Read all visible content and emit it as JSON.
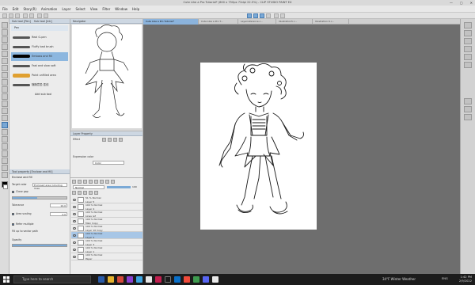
{
  "window": {
    "title": "Cute Like a Pro Tutorial* (600 x 750px 72dpi 22.5%) - CLIP STUDIO PAINT EX",
    "controls": [
      "—",
      "▢",
      "✕"
    ]
  },
  "menu": [
    "File",
    "Edit",
    "Story(R)",
    "Animation",
    "Layer",
    "Select",
    "View",
    "Filter",
    "Window",
    "Help"
  ],
  "subtool": {
    "tab_labels": [
      "Sub tool [Pen]",
      "Sub tool [Ink]"
    ],
    "items": [
      {
        "label": "Pen"
      },
      {
        "label": "Real G-pen"
      },
      {
        "label": "Fluffy bad brush"
      },
      {
        "label": "Emboss and fill"
      },
      {
        "label": "Fast and slow soft"
      },
      {
        "label": "Paint unfilled area"
      },
      {
        "label": "随随意墨·墨线"
      },
      {
        "label": "Add sub tool"
      }
    ]
  },
  "tool_property": {
    "header": "Tool property [Enclose and fill]",
    "name": "Enclose and fill",
    "rows": [
      {
        "label": "Target color",
        "value": "Enclosed area including lines"
      },
      {
        "label": "Close gap",
        "value": ""
      },
      {
        "label": "Tolerance",
        "value": "10.0"
      },
      {
        "label": "Area scaling",
        "value": "2.0"
      },
      {
        "label": "Refer multiple",
        "value": ""
      },
      {
        "label": "Fill up to vector path",
        "value": ""
      },
      {
        "label": "Opacity",
        "value": "100"
      }
    ],
    "close_gap_checked": true,
    "area_scaling_checked": true,
    "refer_multiple_checked": true
  },
  "navigator": {
    "tab": "Navigator"
  },
  "layer_property": {
    "header": "Layer Property",
    "effect_label": "Effect",
    "expression_label": "Expression color",
    "expression_value": "Color"
  },
  "layers": {
    "blend_mode": "Normal",
    "opacity": "100",
    "rows": [
      {
        "name": "51 % Normal",
        "sub": "Layer 5"
      },
      {
        "name": "100 % Normal",
        "sub": "Layer 4"
      },
      {
        "name": "100 % Normal",
        "sub": "Lines ref"
      },
      {
        "name": "100 % Normal",
        "sub": "Main Copy"
      },
      {
        "name": "100 % Normal",
        "sub": "Layer 10 Copy"
      },
      {
        "name": "100 % Normal",
        "sub": "Layer 2"
      },
      {
        "name": "100 % Normal",
        "sub": "Layer 3"
      },
      {
        "name": "100 % Normal",
        "sub": "Layer 1"
      },
      {
        "name": "100 % Normal",
        "sub": "Paper"
      }
    ],
    "selected_index": 5
  },
  "doc_tabs": [
    "Cute Like a Pro Tutorial*",
    "Cute Like a Pro T...",
    "Layerreference.c...",
    "Illustration5.c...",
    "Illustration 6.c..."
  ],
  "taskbar": {
    "search_placeholder": "Type here to search",
    "weather": "34°F  Winter Weather",
    "time": "1:42 PM",
    "date": "2/9/2022",
    "lang": "ENG"
  }
}
